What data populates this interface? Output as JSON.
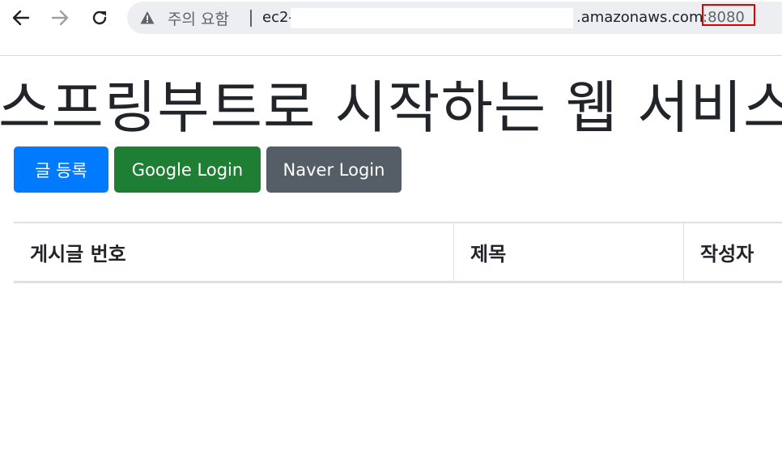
{
  "browser": {
    "security_warning": "주의 요함",
    "url_prefix": "ec2-",
    "url_host": ".amazonaws.com",
    "url_port": ":8080",
    "highlight_color": "#e00000"
  },
  "page": {
    "title": "스프링부트로 시작하는 웹 서비스",
    "buttons": {
      "write": "글 등록",
      "google_login": "Google Login",
      "naver_login": "Naver Login"
    },
    "table": {
      "headers": [
        "게시글 번호",
        "제목",
        "작성자"
      ],
      "rows": []
    }
  },
  "colors": {
    "primary": "#007bff",
    "success": "#1e7e34",
    "secondary": "#555d66"
  },
  "icons": [
    "back-arrow-icon",
    "forward-arrow-icon",
    "reload-icon",
    "warning-icon"
  ]
}
